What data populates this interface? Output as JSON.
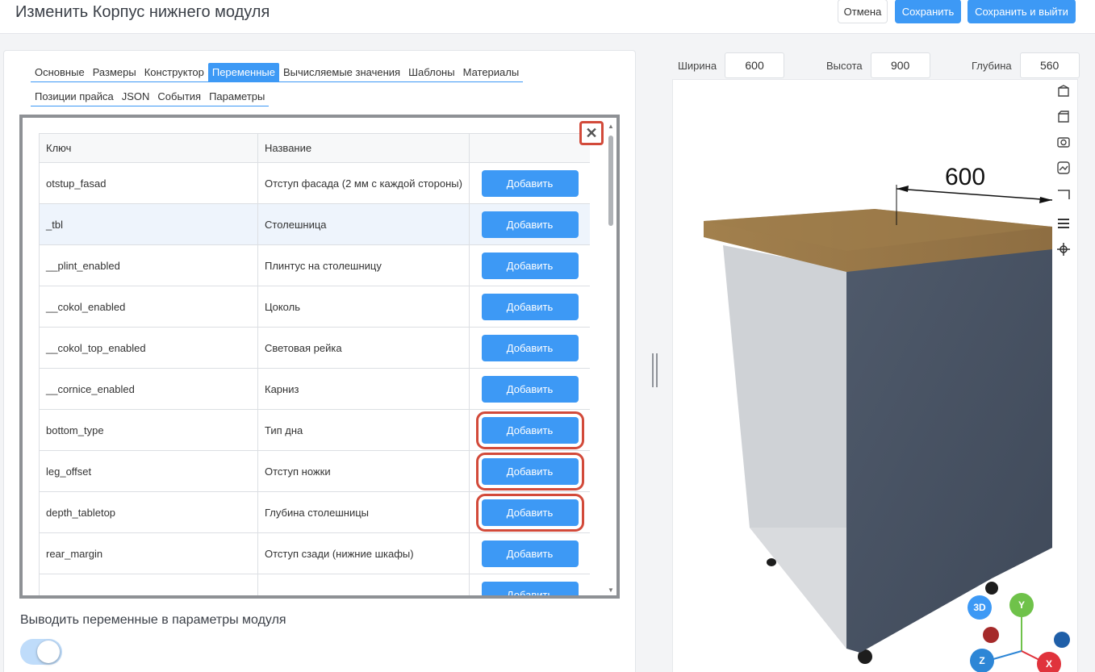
{
  "header": {
    "title": "Изменить Корпус нижнего модуля",
    "cancel": "Отмена",
    "save": "Сохранить",
    "save_exit": "Сохранить и выйти"
  },
  "tabs": {
    "row1": [
      "Основные",
      "Размеры",
      "Конструктор",
      "Переменные",
      "Вычисляемые значения",
      "Шаблоны",
      "Материалы"
    ],
    "row2": [
      "Позиции прайса",
      "JSON",
      "События",
      "Параметры"
    ],
    "active": "Переменные"
  },
  "table": {
    "columns": [
      "Ключ",
      "Название",
      ""
    ],
    "button_label": "Добавить",
    "rows": [
      {
        "key": "otstup_fasad",
        "name": "Отступ фасада (2 мм с каждой стороны)"
      },
      {
        "key": "_tbl",
        "name": "Столешница"
      },
      {
        "key": "__plint_enabled",
        "name": "Плинтус на столешницу"
      },
      {
        "key": "__cokol_enabled",
        "name": "Цоколь"
      },
      {
        "key": "__cokol_top_enabled",
        "name": "Световая рейка"
      },
      {
        "key": "__cornice_enabled",
        "name": "Карниз"
      },
      {
        "key": "bottom_type",
        "name": "Тип дна"
      },
      {
        "key": "leg_offset",
        "name": "Отступ ножки"
      },
      {
        "key": "depth_tabletop",
        "name": "Глубина столешницы"
      },
      {
        "key": "rear_margin",
        "name": "Отступ сзади (нижние шкафы)"
      }
    ]
  },
  "options": {
    "vars_to_params_label": "Выводить переменные в параметры модуля",
    "vars_to_params_on": true
  },
  "dimensions": {
    "width_label": "Ширина",
    "width": "600",
    "height_label": "Высота",
    "height": "900",
    "depth_label": "Глубина",
    "depth": "560"
  },
  "viewport": {
    "dimension_text": "600",
    "axes": {
      "view": "3D",
      "y": "Y",
      "z": "Z",
      "x": "X"
    }
  },
  "colors": {
    "accent": "#3d99f5",
    "highlight": "#d24a3a",
    "countertop": "#9a7a4a",
    "cabinet_side": "#4a5566"
  }
}
